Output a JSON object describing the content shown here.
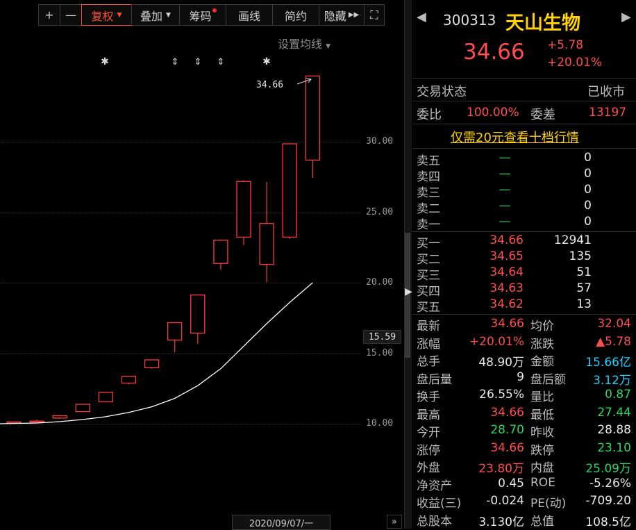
{
  "toolbar": {
    "plus": "+",
    "minus": "—",
    "adjust": "复权",
    "overlay": "叠加",
    "chips": "筹码",
    "draw": "画线",
    "simple": "简约",
    "hide": "隐藏",
    "fullscreen": "⛶"
  },
  "chart": {
    "ma_setting": "设置均线",
    "y_labels": [
      "30.00",
      "25.00",
      "20.00",
      "15.00",
      "10.00"
    ],
    "current_price": "15.59",
    "high_annotation": "34.66",
    "date": "2020/09/07/一",
    "expand": "»",
    "colors": {
      "candle": "#ff3b3b",
      "ma": "#ffffff",
      "grid": "#3d2a2a"
    }
  },
  "chart_data": {
    "type": "candlestick",
    "y_ticks": [
      10,
      15,
      20,
      25,
      30
    ],
    "candles": [
      {
        "open": 10.13,
        "close": 10.1,
        "high": 10.15,
        "low": 10.08
      },
      {
        "open": 10.19,
        "close": 10.17,
        "high": 10.28,
        "low": 10.15
      },
      {
        "open": 10.57,
        "close": 10.4,
        "high": 10.6,
        "low": 10.35
      },
      {
        "open": 11.38,
        "close": 10.86,
        "high": 11.4,
        "low": 10.84
      },
      {
        "open": 12.23,
        "close": 11.56,
        "high": 12.28,
        "low": 11.53
      },
      {
        "open": 13.36,
        "close": 12.88,
        "high": 13.4,
        "low": 12.8
      },
      {
        "open": 14.53,
        "close": 13.97,
        "high": 14.55,
        "low": 13.9
      },
      {
        "open": 17.17,
        "close": 15.93,
        "high": 17.2,
        "low": 15.06
      },
      {
        "open": 19.13,
        "close": 16.42,
        "high": 19.15,
        "low": 15.67
      },
      {
        "open": 23.01,
        "close": 21.37,
        "high": 23.05,
        "low": 20.92
      },
      {
        "open": 27.18,
        "close": 23.23,
        "high": 27.25,
        "low": 22.66
      },
      {
        "open": 24.2,
        "close": 21.3,
        "high": 27.15,
        "low": 20.04
      },
      {
        "open": 29.85,
        "close": 23.23,
        "high": 29.9,
        "low": 23.11
      },
      {
        "open": 34.66,
        "close": 28.7,
        "high": 34.66,
        "low": 27.44
      }
    ],
    "ma_line": [
      10.0,
      10.05,
      10.15,
      10.3,
      10.5,
      10.8,
      11.2,
      11.8,
      12.7,
      13.9,
      15.5,
      17.1,
      18.6,
      20.0
    ]
  },
  "header": {
    "code": "300313",
    "name": "天山生物",
    "price": "34.66",
    "change": "+5.78",
    "change_pct": "+20.01%",
    "prev_arrow": "◀",
    "next_arrow": "▶"
  },
  "status": {
    "trade_status_label": "交易状态",
    "trade_status_value": "已收市",
    "ratio_label": "委比",
    "ratio_value": "100.00%",
    "diff_label": "委差",
    "diff_value": "13197"
  },
  "promo": "仅需20元查看十档行情",
  "order_book": {
    "asks": [
      {
        "label": "卖五",
        "price": "—",
        "vol": "0"
      },
      {
        "label": "卖四",
        "price": "—",
        "vol": "0"
      },
      {
        "label": "卖三",
        "price": "—",
        "vol": "0"
      },
      {
        "label": "卖二",
        "price": "—",
        "vol": "0"
      },
      {
        "label": "卖一",
        "price": "—",
        "vol": "0"
      }
    ],
    "bids": [
      {
        "label": "买一",
        "price": "34.66",
        "vol": "12941"
      },
      {
        "label": "买二",
        "price": "34.65",
        "vol": "135"
      },
      {
        "label": "买三",
        "price": "34.64",
        "vol": "51"
      },
      {
        "label": "买四",
        "price": "34.63",
        "vol": "57"
      },
      {
        "label": "买五",
        "price": "34.62",
        "vol": "13"
      }
    ]
  },
  "stats": [
    {
      "l1": "最新",
      "v1": "34.66",
      "c1": "red",
      "l2": "均价",
      "v2": "32.04",
      "c2": "red"
    },
    {
      "l1": "涨幅",
      "v1": "+20.01%",
      "c1": "red",
      "l2": "涨跌",
      "v2": "▲5.78",
      "c2": "red"
    },
    {
      "l1": "总手",
      "v1": "48.90万",
      "c1": "white",
      "l2": "金额",
      "v2": "15.66亿",
      "c2": "cyan"
    },
    {
      "l1": "盘后量",
      "v1": "9",
      "c1": "white",
      "l2": "盘后额",
      "v2": "3.12万",
      "c2": "cyan"
    },
    {
      "l1": "换手",
      "v1": "26.55%",
      "c1": "white",
      "l2": "量比",
      "v2": "0.87",
      "c2": "green"
    },
    {
      "l1": "最高",
      "v1": "34.66",
      "c1": "red",
      "l2": "最低",
      "v2": "27.44",
      "c2": "green"
    },
    {
      "l1": "今开",
      "v1": "28.70",
      "c1": "green",
      "l2": "昨收",
      "v2": "28.88",
      "c2": "white"
    },
    {
      "l1": "涨停",
      "v1": "34.66",
      "c1": "red",
      "l2": "跌停",
      "v2": "23.10",
      "c2": "green"
    },
    {
      "l1": "外盘",
      "v1": "23.80万",
      "c1": "red",
      "l2": "内盘",
      "v2": "25.09万",
      "c2": "green"
    },
    {
      "l1": "净资产",
      "v1": "0.45",
      "c1": "white",
      "l2": "ROE",
      "v2": "-5.26%",
      "c2": "white"
    },
    {
      "l1": "收益(三)",
      "v1": "-0.024",
      "c1": "white",
      "l2": "PE(动)",
      "v2": "-709.20",
      "c2": "white"
    },
    {
      "l1": "总股本",
      "v1": "3.130亿",
      "c1": "white",
      "l2": "总值",
      "v2": "108.5亿",
      "c2": "white"
    }
  ]
}
